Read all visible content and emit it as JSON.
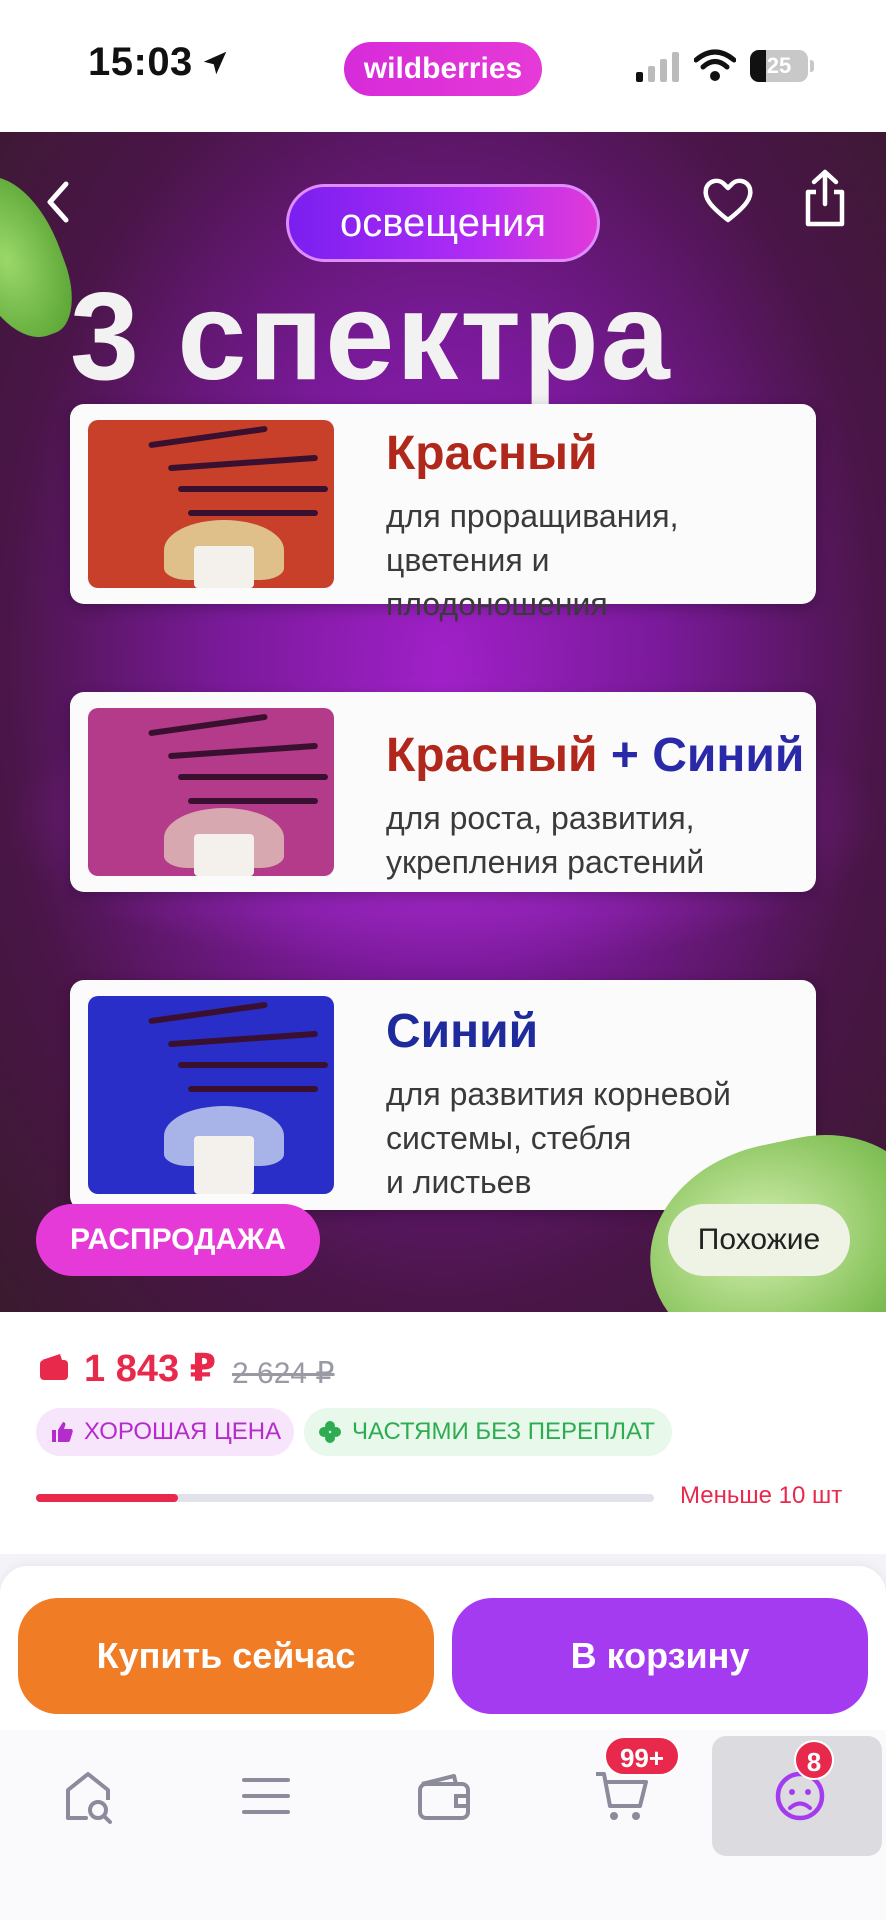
{
  "status_bar": {
    "time": "15:03",
    "brand": "wildberries",
    "battery_level": "25",
    "icons": [
      "location-arrow-icon",
      "cellular-signal-icon",
      "wifi-icon",
      "battery-icon"
    ]
  },
  "hero": {
    "top_badge": "освещения",
    "title": "3 спектра",
    "nav_icons": [
      "chevron-left-icon",
      "heart-icon",
      "share-icon"
    ],
    "cards": [
      {
        "title_parts": [
          "Красный"
        ],
        "title_colors": [
          "#b0281c"
        ],
        "desc": [
          "для проращивания,",
          "цветения и",
          "плодоношения"
        ],
        "image_bg": "#c9402a"
      },
      {
        "title_parts": [
          "Красный",
          " + ",
          "Синий"
        ],
        "title_colors": [
          "#b0281c",
          "#2a2aa8",
          "#2a2aa8"
        ],
        "desc": [
          "для роста, развития,",
          "укрепления растений"
        ],
        "image_bg": "#b43a8a"
      },
      {
        "title_parts": [
          "Синий"
        ],
        "title_colors": [
          "#1f2a9c"
        ],
        "desc": [
          "для развития корневой",
          "системы, стебля",
          "и листьев"
        ],
        "image_bg": "#2a2ec8"
      }
    ],
    "sale_chip": "РАСПРОДАЖА",
    "similar_chip": "Похожие"
  },
  "price": {
    "current": "1 843 ₽",
    "old": "2 624 ₽",
    "tags": [
      "ХОРОШАЯ ЦЕНА",
      "ЧАСТЯМИ БЕЗ ПЕРЕПЛАТ"
    ],
    "tag_icons": [
      "thumbs-up-icon",
      "clover-icon"
    ],
    "stock_text": "Меньше 10 шт",
    "stock_fraction": 0.23
  },
  "actions": {
    "buy_now": "Купить сейчас",
    "add_to_cart": "В корзину",
    "colors": {
      "buy": "#f07c26",
      "cart": "#a53bf0"
    }
  },
  "tabbar": {
    "items": [
      {
        "icon": "home-search-icon"
      },
      {
        "icon": "catalog-menu-icon"
      },
      {
        "icon": "wallet-icon"
      },
      {
        "icon": "cart-icon",
        "badge": "99+"
      },
      {
        "icon": "profile-icon",
        "badge": "8",
        "active": true
      }
    ]
  },
  "colors": {
    "accent": "#e63ad8",
    "price": "#e8294c"
  }
}
